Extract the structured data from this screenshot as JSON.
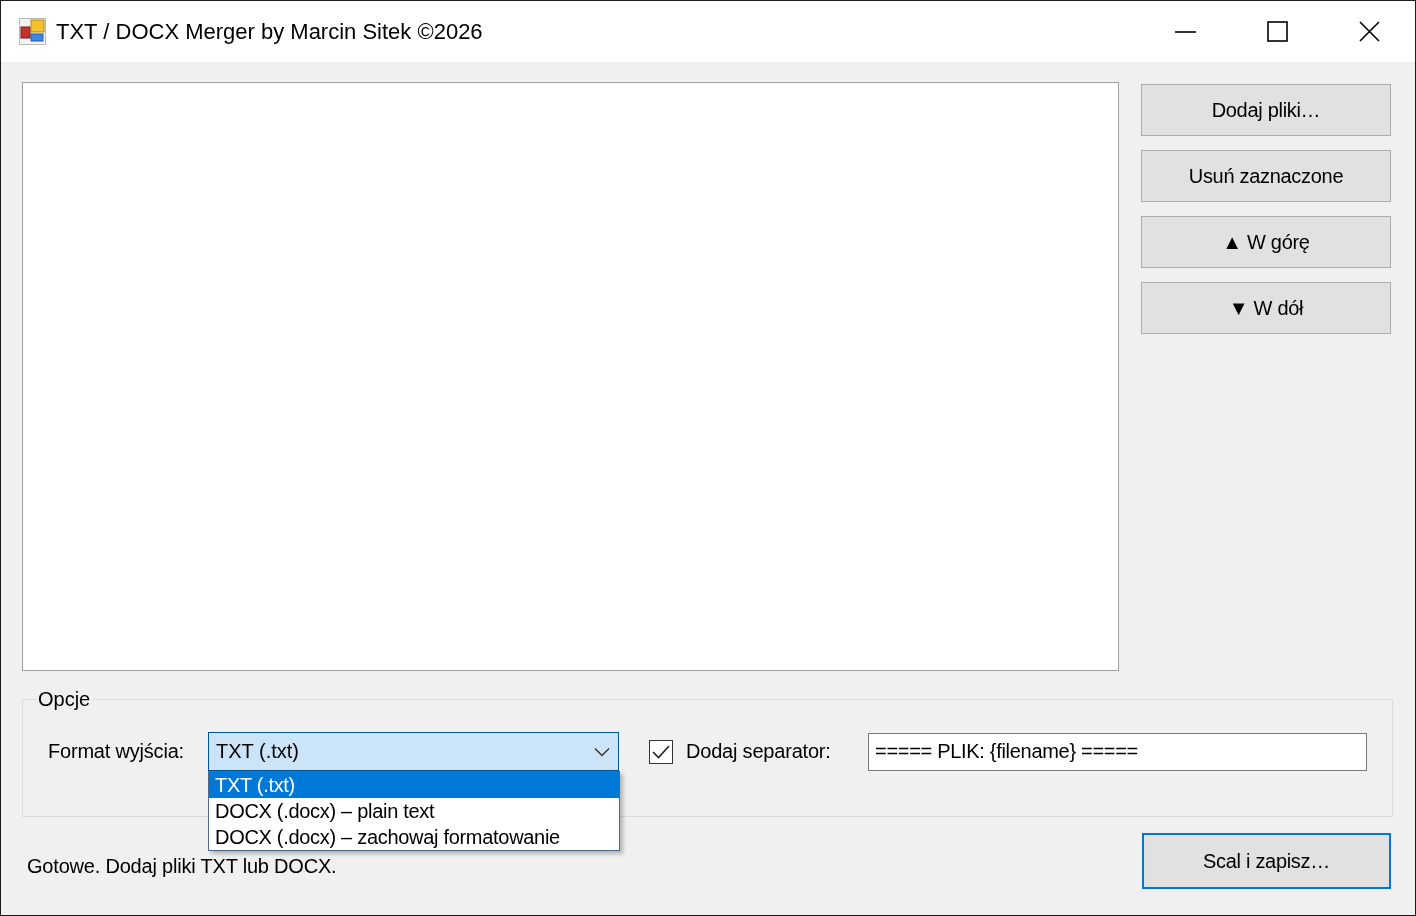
{
  "window": {
    "title": "TXT / DOCX Merger by Marcin Sitek ©2026"
  },
  "side_buttons": [
    {
      "label": "Dodaj pliki…"
    },
    {
      "label": "Usuń zaznaczone"
    },
    {
      "label": "▲ W górę"
    },
    {
      "label": "▼ W dół"
    }
  ],
  "options": {
    "title": "Opcje",
    "format_label": "Format wyjścia:",
    "format_select": {
      "value": "TXT (.txt)",
      "expanded": true,
      "options": [
        {
          "label": "TXT (.txt)",
          "selected": true
        },
        {
          "label": "DOCX (.docx) – plain text",
          "selected": false
        },
        {
          "label": "DOCX (.docx) – zachowaj formatowanie",
          "selected": false
        }
      ]
    },
    "separator": {
      "label": "Dodaj separator:",
      "checked": true,
      "value": "===== PLIK: {filename} ====="
    }
  },
  "status_bar": {
    "text": "Gotowe. Dodaj pliki TXT lub DOCX."
  },
  "merge_button": {
    "label": "Scal i zapisz…",
    "default": true
  }
}
